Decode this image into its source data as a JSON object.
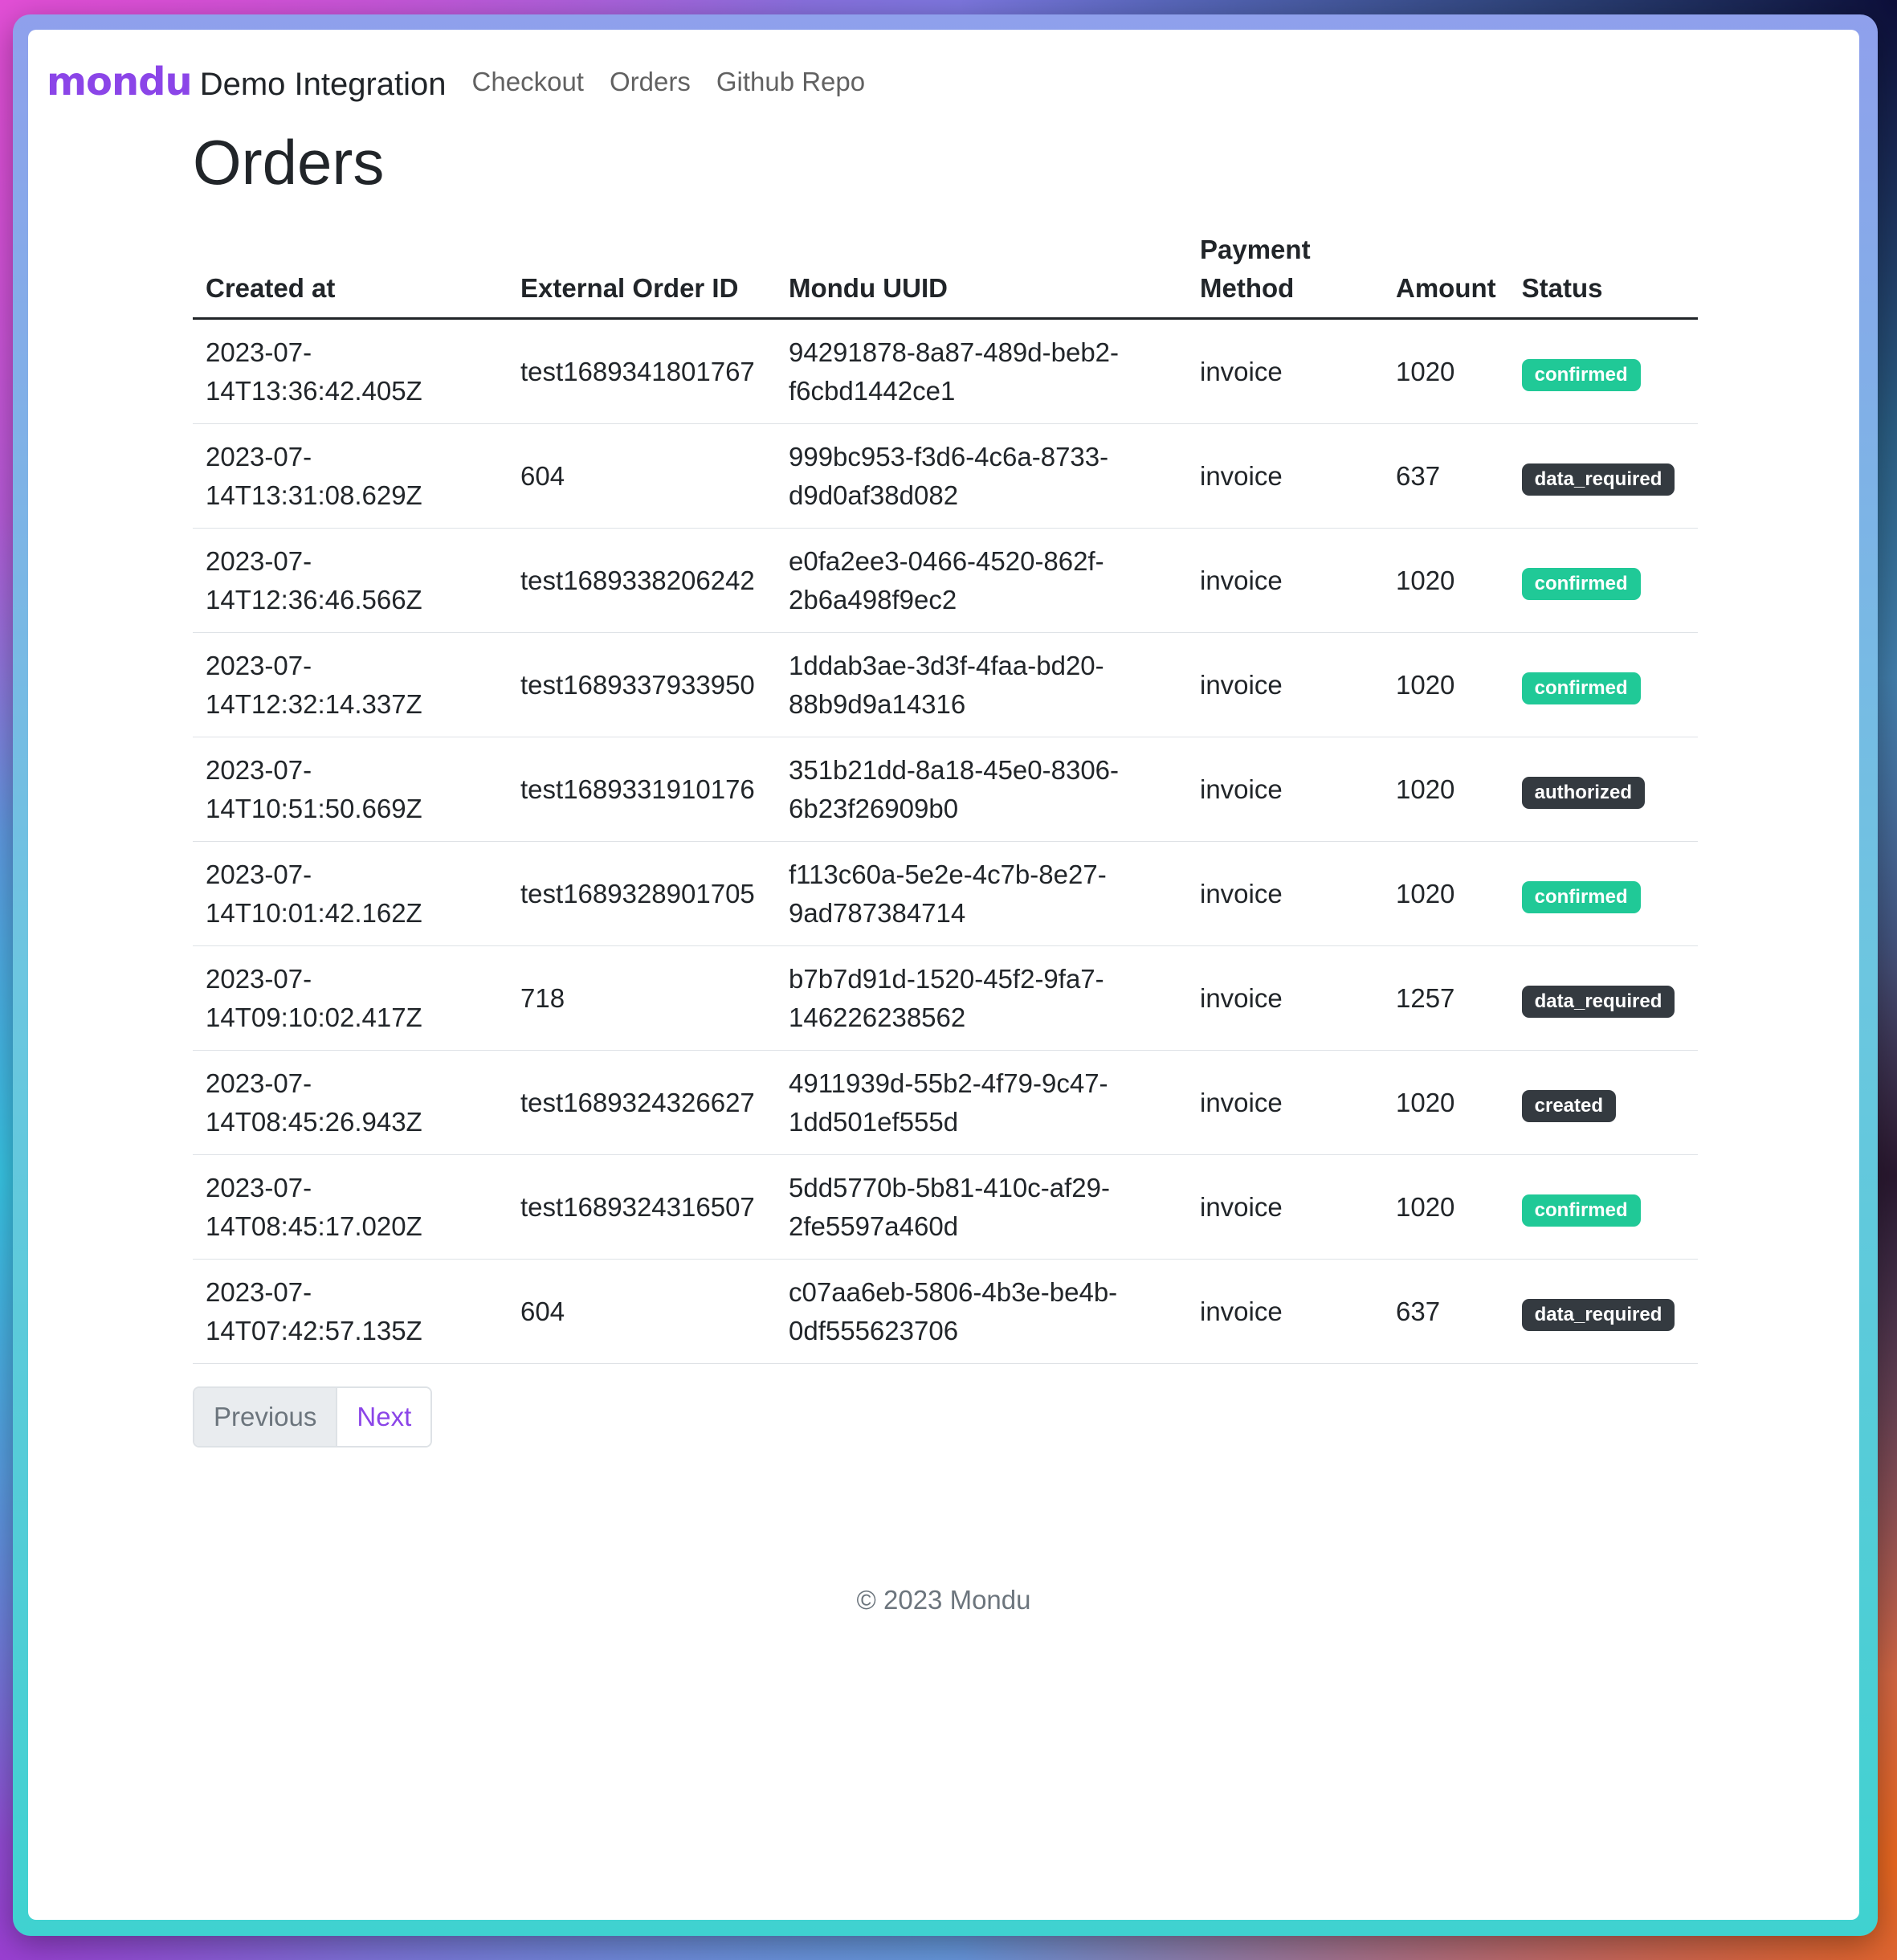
{
  "brand": {
    "logo": "mondu",
    "text": "Demo Integration"
  },
  "nav": {
    "checkout": "Checkout",
    "orders": "Orders",
    "github": "Github Repo"
  },
  "page_title": "Orders",
  "table": {
    "headers": {
      "created_at": "Created at",
      "external_order_id": "External Order ID",
      "mondu_uuid": "Mondu UUID",
      "payment_method": "Payment Method",
      "amount": "Amount",
      "status": "Status"
    },
    "rows": [
      {
        "created_at": "2023-07-14T13:36:42.405Z",
        "external_order_id": "test1689341801767",
        "mondu_uuid": "94291878-8a87-489d-beb2-f6cbd1442ce1",
        "payment_method": "invoice",
        "amount": "1020",
        "status": "confirmed"
      },
      {
        "created_at": "2023-07-14T13:31:08.629Z",
        "external_order_id": "604",
        "mondu_uuid": "999bc953-f3d6-4c6a-8733-d9d0af38d082",
        "payment_method": "invoice",
        "amount": "637",
        "status": "data_required"
      },
      {
        "created_at": "2023-07-14T12:36:46.566Z",
        "external_order_id": "test1689338206242",
        "mondu_uuid": "e0fa2ee3-0466-4520-862f-2b6a498f9ec2",
        "payment_method": "invoice",
        "amount": "1020",
        "status": "confirmed"
      },
      {
        "created_at": "2023-07-14T12:32:14.337Z",
        "external_order_id": "test1689337933950",
        "mondu_uuid": "1ddab3ae-3d3f-4faa-bd20-88b9d9a14316",
        "payment_method": "invoice",
        "amount": "1020",
        "status": "confirmed"
      },
      {
        "created_at": "2023-07-14T10:51:50.669Z",
        "external_order_id": "test1689331910176",
        "mondu_uuid": "351b21dd-8a18-45e0-8306-6b23f26909b0",
        "payment_method": "invoice",
        "amount": "1020",
        "status": "authorized"
      },
      {
        "created_at": "2023-07-14T10:01:42.162Z",
        "external_order_id": "test1689328901705",
        "mondu_uuid": "f113c60a-5e2e-4c7b-8e27-9ad787384714",
        "payment_method": "invoice",
        "amount": "1020",
        "status": "confirmed"
      },
      {
        "created_at": "2023-07-14T09:10:02.417Z",
        "external_order_id": "718",
        "mondu_uuid": "b7b7d91d-1520-45f2-9fa7-146226238562",
        "payment_method": "invoice",
        "amount": "1257",
        "status": "data_required"
      },
      {
        "created_at": "2023-07-14T08:45:26.943Z",
        "external_order_id": "test1689324326627",
        "mondu_uuid": "4911939d-55b2-4f79-9c47-1dd501ef555d",
        "payment_method": "invoice",
        "amount": "1020",
        "status": "created"
      },
      {
        "created_at": "2023-07-14T08:45:17.020Z",
        "external_order_id": "test1689324316507",
        "mondu_uuid": "5dd5770b-5b81-410c-af29-2fe5597a460d",
        "payment_method": "invoice",
        "amount": "1020",
        "status": "confirmed"
      },
      {
        "created_at": "2023-07-14T07:42:57.135Z",
        "external_order_id": "604",
        "mondu_uuid": "c07aa6eb-5806-4b3e-be4b-0df555623706",
        "payment_method": "invoice",
        "amount": "637",
        "status": "data_required"
      }
    ]
  },
  "pagination": {
    "previous": "Previous",
    "next": "Next"
  },
  "footer": "© 2023 Mondu",
  "colors": {
    "brand_purple": "#8b45e8",
    "badge_confirmed": "#20c997",
    "badge_dark": "#343a40"
  }
}
